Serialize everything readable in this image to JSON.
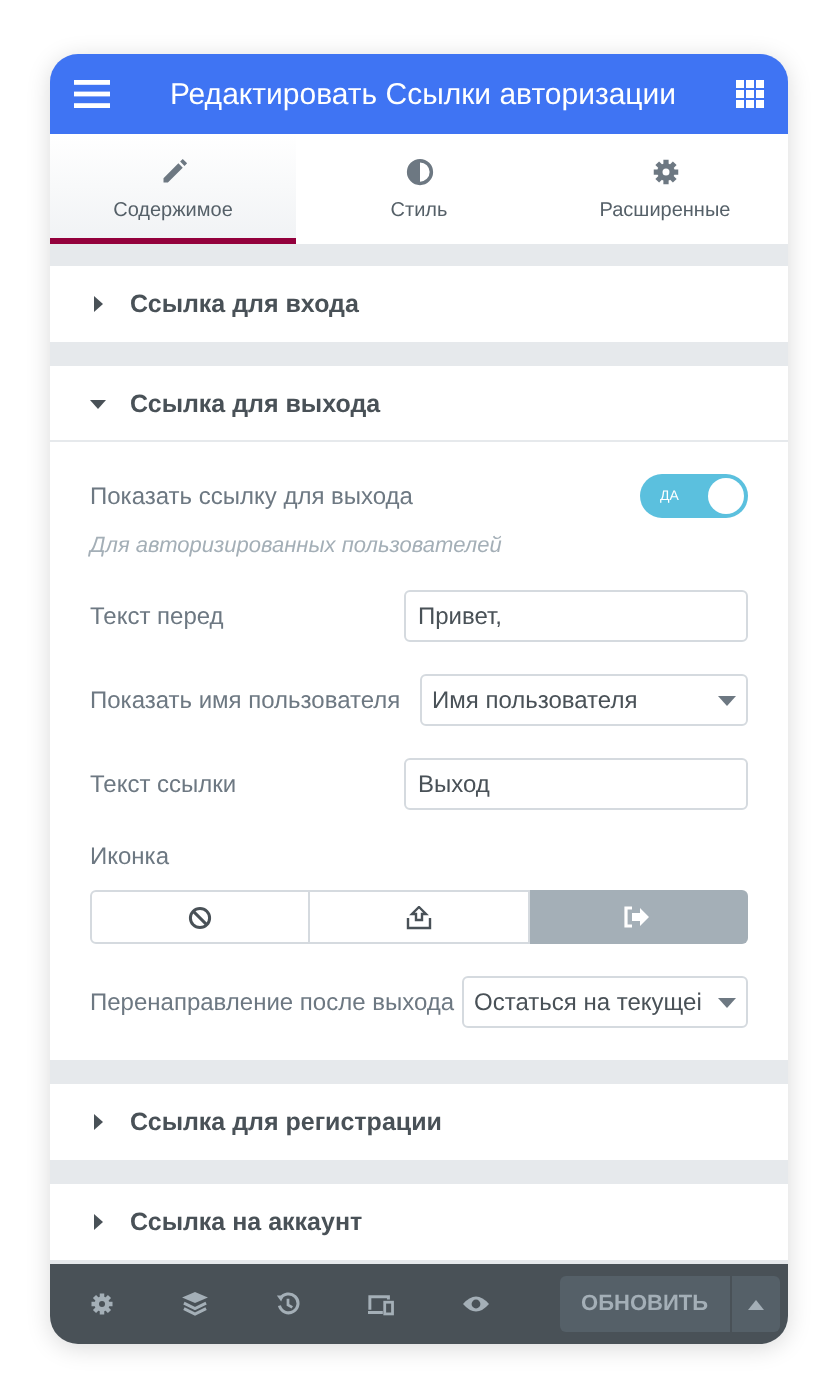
{
  "header": {
    "title": "Редактировать Ссылки авторизации"
  },
  "tabs": [
    {
      "label": "Содержимое",
      "kind": "content",
      "selected": true
    },
    {
      "label": "Стиль",
      "kind": "style",
      "selected": false
    },
    {
      "label": "Расширенные",
      "kind": "advanced",
      "selected": false
    }
  ],
  "sections": [
    {
      "title": "Ссылка для входа",
      "expanded": false
    },
    {
      "title": "Ссылка для выхода",
      "expanded": true,
      "controls": [
        {
          "kind": "switch",
          "label": "Показать ссылку для выхода",
          "on": true,
          "on_text": "ДА"
        },
        {
          "kind": "note",
          "text": "Для авторизированных пользователей"
        },
        {
          "kind": "text",
          "label": "Текст перед",
          "value": "Привет,"
        },
        {
          "kind": "select",
          "label": "Показать имя пользователя",
          "value": "Имя пользователя"
        },
        {
          "kind": "text",
          "label": "Текст ссылки",
          "value": "Выход"
        },
        {
          "kind": "choices",
          "label": "Иконка",
          "options": [
            {
              "kind": "none",
              "selected": false
            },
            {
              "kind": "upload",
              "selected": false
            },
            {
              "kind": "exit",
              "selected": true
            }
          ]
        },
        {
          "kind": "select",
          "label": "Перенаправление после выхода",
          "value": "Остаться на текущеі"
        }
      ]
    },
    {
      "title": "Ссылка для регистрации",
      "expanded": false
    },
    {
      "title": "Ссылка на аккаунт",
      "expanded": false
    }
  ],
  "footer": {
    "button": "ОБНОВИТЬ"
  }
}
